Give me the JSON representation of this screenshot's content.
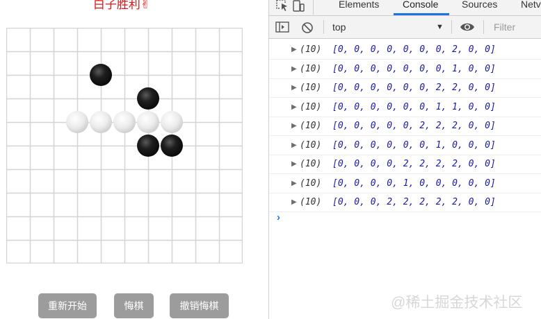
{
  "game": {
    "title": "白子胜利✌",
    "board_size": 10,
    "stones": [
      {
        "row": 2,
        "col": 4,
        "color": "black"
      },
      {
        "row": 3,
        "col": 6,
        "color": "black"
      },
      {
        "row": 4,
        "col": 3,
        "color": "white"
      },
      {
        "row": 4,
        "col": 4,
        "color": "white"
      },
      {
        "row": 4,
        "col": 5,
        "color": "white"
      },
      {
        "row": 4,
        "col": 6,
        "color": "white"
      },
      {
        "row": 4,
        "col": 7,
        "color": "white"
      },
      {
        "row": 5,
        "col": 6,
        "color": "black"
      },
      {
        "row": 5,
        "col": 7,
        "color": "black"
      }
    ],
    "buttons": {
      "restart": "重新开始",
      "undo": "悔棋",
      "cancel_undo": "撤销悔棋"
    }
  },
  "devtools": {
    "tabs": [
      "Elements",
      "Console",
      "Sources",
      "Netv"
    ],
    "active_tab": "Console",
    "context": "top",
    "filter_placeholder": "Filter",
    "logs": [
      {
        "count": "(10)",
        "array": "[0, 0, 0, 0, 0, 0, 0, 2, 0, 0]"
      },
      {
        "count": "(10)",
        "array": "[0, 0, 0, 0, 0, 0, 0, 1, 0, 0]"
      },
      {
        "count": "(10)",
        "array": "[0, 0, 0, 0, 0, 0, 2, 2, 0, 0]"
      },
      {
        "count": "(10)",
        "array": "[0, 0, 0, 0, 0, 0, 1, 1, 0, 0]"
      },
      {
        "count": "(10)",
        "array": "[0, 0, 0, 0, 0, 2, 2, 2, 0, 0]"
      },
      {
        "count": "(10)",
        "array": "[0, 0, 0, 0, 0, 0, 1, 0, 0, 0]"
      },
      {
        "count": "(10)",
        "array": "[0, 0, 0, 0, 2, 2, 2, 2, 0, 0]"
      },
      {
        "count": "(10)",
        "array": "[0, 0, 0, 0, 1, 0, 0, 0, 0, 0]"
      },
      {
        "count": "(10)",
        "array": "[0, 0, 0, 2, 2, 2, 2, 2, 0, 0]"
      }
    ],
    "prompt": "›"
  },
  "watermark": "@稀土掘金技术社区",
  "colors": {
    "title_red": "#e01414",
    "button_gray": "#9c9c9c",
    "grid_line": "#d4d4d4",
    "array_blue": "#1a1aa6",
    "tab_active_blue": "#1a73e8"
  }
}
